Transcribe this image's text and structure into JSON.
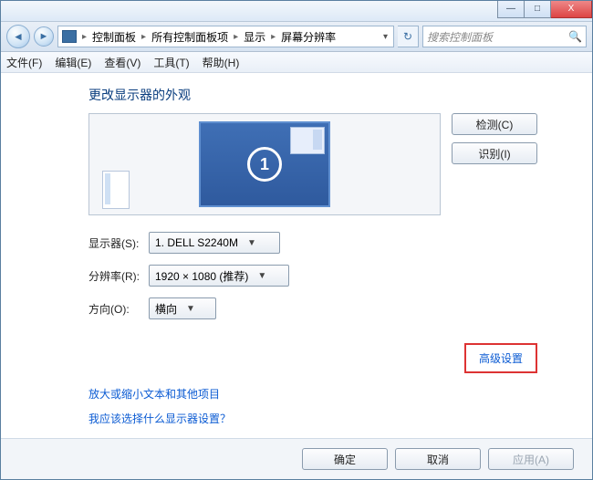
{
  "window_controls": {
    "min": "—",
    "max": "□",
    "close": "X"
  },
  "breadcrumbs": {
    "root": "控制面板",
    "all": "所有控制面板项",
    "display": "显示",
    "res": "屏幕分辨率"
  },
  "search": {
    "placeholder": "搜索控制面板"
  },
  "menu": {
    "file": "文件(F)",
    "edit": "编辑(E)",
    "view": "查看(V)",
    "tools": "工具(T)",
    "help": "帮助(H)"
  },
  "page_title": "更改显示器的外观",
  "monitor_number": "1",
  "side_buttons": {
    "detect": "检测(C)",
    "identify": "识别(I)"
  },
  "labels": {
    "display": "显示器(S):",
    "resolution": "分辨率(R):",
    "orientation": "方向(O):"
  },
  "values": {
    "display": "1. DELL S2240M",
    "resolution": "1920 × 1080 (推荐)",
    "orientation": "横向"
  },
  "links": {
    "advanced": "高级设置",
    "text_size": "放大或缩小文本和其他项目",
    "which": "我应该选择什么显示器设置？"
  },
  "footer": {
    "ok": "确定",
    "cancel": "取消",
    "apply": "应用(A)"
  }
}
